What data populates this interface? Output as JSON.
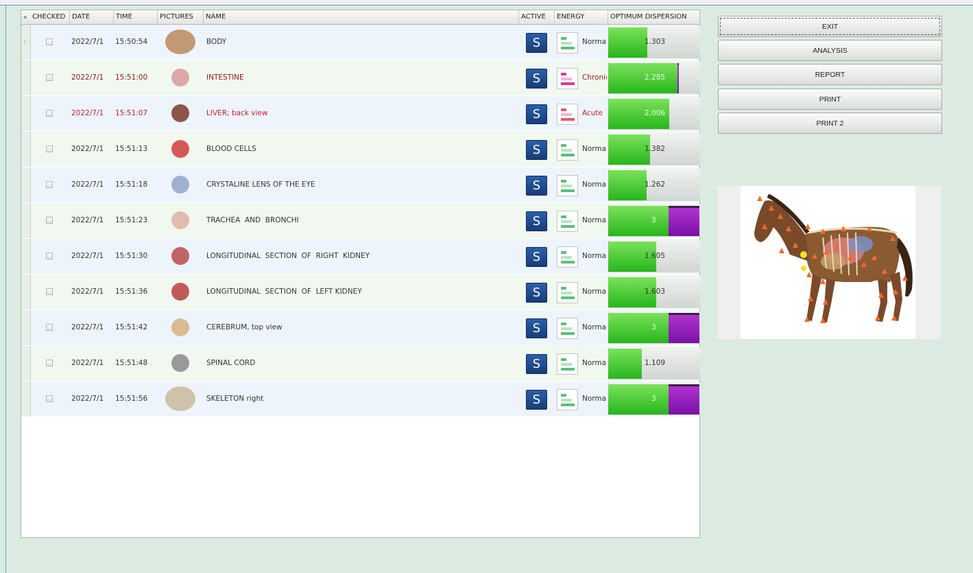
{
  "grid": {
    "headers": [
      "CHECKED",
      "DATE",
      "TIME",
      "PICTURES",
      "NAME",
      "ACTIVE",
      "ENERGY",
      "OPTIMUM DISPERSION"
    ],
    "rows": [
      {
        "date": "2022/7/1",
        "time": "15:50:54",
        "name": "BODY",
        "energy": "Normal",
        "energy_shown": "Norma",
        "dispersion": "1.303",
        "fill_pct": 43,
        "purple": false,
        "color": "normal"
      },
      {
        "date": "2022/7/1",
        "time": "15:51:00",
        "name": "INTESTINE",
        "energy": "Chronic",
        "energy_shown": "Chronic",
        "dispersion": "2.285",
        "fill_pct": 76,
        "purple": true,
        "color": "darkred"
      },
      {
        "date": "2022/7/1",
        "time": "15:51:07",
        "name": "LIVER; back view",
        "energy": "Acute",
        "energy_shown": "Acute",
        "dispersion": "2.006",
        "fill_pct": 67,
        "purple": false,
        "color": "red"
      },
      {
        "date": "2022/7/1",
        "time": "15:51:13",
        "name": "BLOOD CELLS",
        "energy": "Normal",
        "energy_shown": "Norma",
        "dispersion": "1.382",
        "fill_pct": 46,
        "purple": false,
        "color": "normal"
      },
      {
        "date": "2022/7/1",
        "time": "15:51:18",
        "name": "CRYSTALINE LENS OF THE EYE",
        "energy": "Normal",
        "energy_shown": "Norma",
        "dispersion": "1.262",
        "fill_pct": 42,
        "purple": false,
        "color": "normal"
      },
      {
        "date": "2022/7/1",
        "time": "15:51:23",
        "name": "TRACHEA  AND  BRONCHI",
        "energy": "Normal",
        "energy_shown": "Norma",
        "dispersion": "3",
        "fill_pct": 66,
        "purple": true,
        "color": "normal"
      },
      {
        "date": "2022/7/1",
        "time": "15:51:30",
        "name": "LONGITUDINAL  SECTION  OF  RIGHT  KIDNEY",
        "energy": "Normal",
        "energy_shown": "Norma",
        "dispersion": "1.605",
        "fill_pct": 53,
        "purple": false,
        "color": "normal"
      },
      {
        "date": "2022/7/1",
        "time": "15:51:36",
        "name": "LONGITUDINAL  SECTION  OF  LEFT KIDNEY",
        "energy": "Normal",
        "energy_shown": "Norma",
        "dispersion": "1.603",
        "fill_pct": 53,
        "purple": false,
        "color": "normal"
      },
      {
        "date": "2022/7/1",
        "time": "15:51:42",
        "name": "CEREBRUM, top view",
        "energy": "Normal",
        "energy_shown": "Norma",
        "dispersion": "3",
        "fill_pct": 66,
        "purple": true,
        "color": "normal"
      },
      {
        "date": "2022/7/1",
        "time": "15:51:48",
        "name": "SPINAL CORD",
        "energy": "Normal",
        "energy_shown": "Norma",
        "dispersion": "1.109",
        "fill_pct": 37,
        "purple": false,
        "color": "normal"
      },
      {
        "date": "2022/7/1",
        "time": "15:51:56",
        "name": "SKELETON right",
        "energy": "Normal",
        "energy_shown": "Norma",
        "dispersion": "3",
        "fill_pct": 66,
        "purple": true,
        "color": "normal"
      }
    ],
    "active_label": "S"
  },
  "buttons": {
    "exit": "EXIT",
    "analysis": "ANALYSIS",
    "report": "REPORT",
    "print": "PRINT",
    "print2": "PRINT 2"
  },
  "colors": {
    "background": "#dcebe1",
    "fill_green": "#3cc52a",
    "fill_purple": "#9a1fc2",
    "active_blue": "#1e4c8e",
    "acute_red": "#c0202a",
    "chronic_red": "#8b1a1a"
  },
  "icons": {
    "active": "s-square-icon",
    "energy": "energy-bars-icon",
    "horse_image": "horse-anatomy-image"
  }
}
